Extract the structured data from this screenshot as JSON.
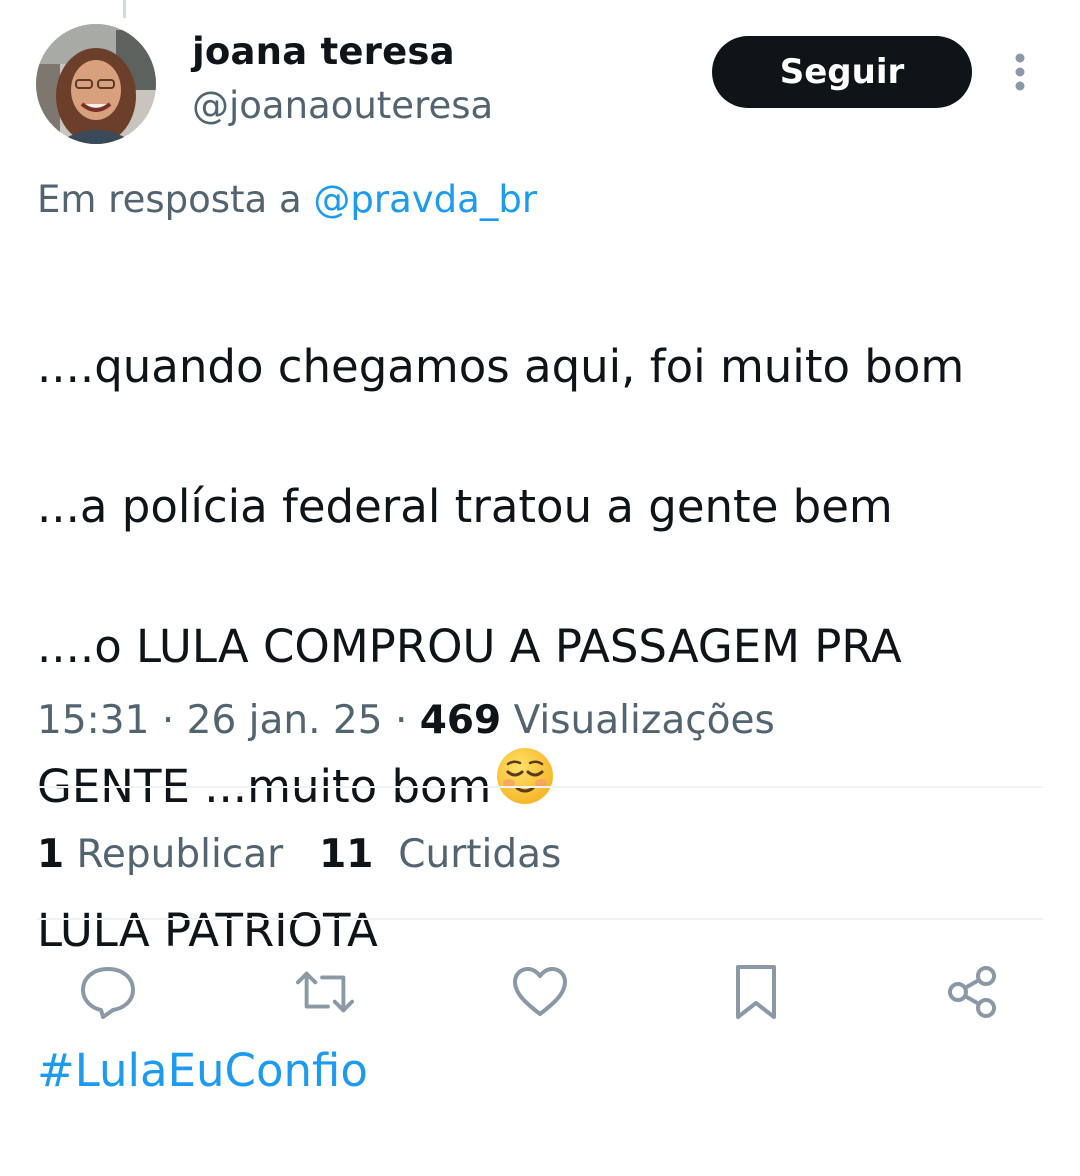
{
  "author": {
    "display_name": "joana teresa",
    "handle": "@joanaouteresa"
  },
  "header": {
    "follow_label": "Seguir",
    "more_icon": "more-vertical-icon"
  },
  "reply_context": {
    "prefix": "Em resposta a",
    "mention": "@pravda_br"
  },
  "tweet": {
    "lines": [
      "....quando chegamos aqui, foi muito bom",
      "...a polícia federal tratou a gente bem",
      "....o LULA COMPROU A PASSAGEM PRA",
      "GENTE ...muito bom",
      "LULA PATRIOTA"
    ],
    "emoji": "relieved-face-emoji",
    "hashtag": "#LulaEuConfio"
  },
  "meta": {
    "time": "15:31",
    "separator": "·",
    "date": "26 jan. 25",
    "views_count": "469",
    "views_label": "Visualizações"
  },
  "stats": {
    "reposts_count": "1",
    "reposts_label": "Republicar",
    "likes_count": "11",
    "likes_label": "Curtidas"
  },
  "actions": [
    {
      "name": "reply-button",
      "icon": "reply-icon"
    },
    {
      "name": "repost-button",
      "icon": "repost-icon"
    },
    {
      "name": "like-button",
      "icon": "heart-icon"
    },
    {
      "name": "bookmark-button",
      "icon": "bookmark-icon"
    },
    {
      "name": "share-button",
      "icon": "share-icon"
    }
  ],
  "colors": {
    "text_primary": "#0f1419",
    "text_secondary": "#536471",
    "link": "#1d9bf0",
    "divider": "#eff3f4",
    "icon": "#8b98a5",
    "button_bg": "#0f1419"
  }
}
